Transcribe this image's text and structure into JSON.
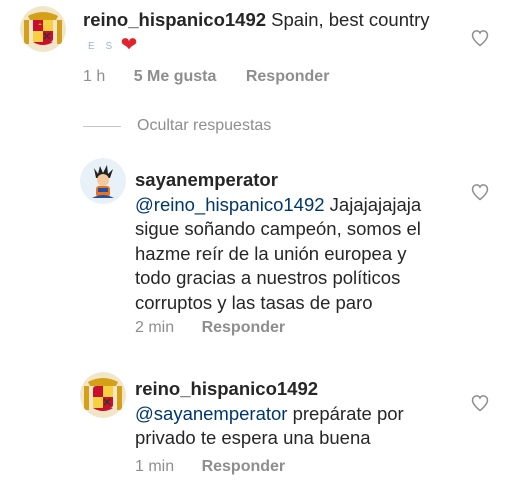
{
  "comments": [
    {
      "username": "reino_hispanico1492",
      "text": "Spain, best country",
      "emoji_letters": "E S",
      "time": "1 h",
      "likes": "5 Me gusta",
      "reply": "Responder",
      "avatar_icon": "spanish-coat-of-arms",
      "heart_icon": "heart-outline"
    }
  ],
  "hide_replies": "Ocultar respuestas",
  "replies": [
    {
      "username": "sayanemperator",
      "mention": "@reino_hispanico1492",
      "text_line1": "Jajajajajaja",
      "text_lines": [
        "sigue soñando campeón, somos el",
        "hazme reír de la unión europea y",
        "todo gracias a nuestros políticos",
        "corruptos y las tasas de paro"
      ],
      "time": "2 min",
      "reply": "Responder",
      "avatar_icon": "anime-character",
      "heart_icon": "heart-outline"
    },
    {
      "username": "reino_hispanico1492",
      "mention": "@sayanemperator",
      "text_line1": "prepárate por",
      "text_lines": [
        "privado te espera una buena"
      ],
      "time": "1 min",
      "reply": "Responder",
      "avatar_icon": "spanish-coat-of-arms",
      "heart_icon": "heart-outline"
    }
  ],
  "colors": {
    "username": "#262626",
    "mention": "#00376b",
    "meta": "#8e8e8e",
    "heart": "#e0242c"
  }
}
